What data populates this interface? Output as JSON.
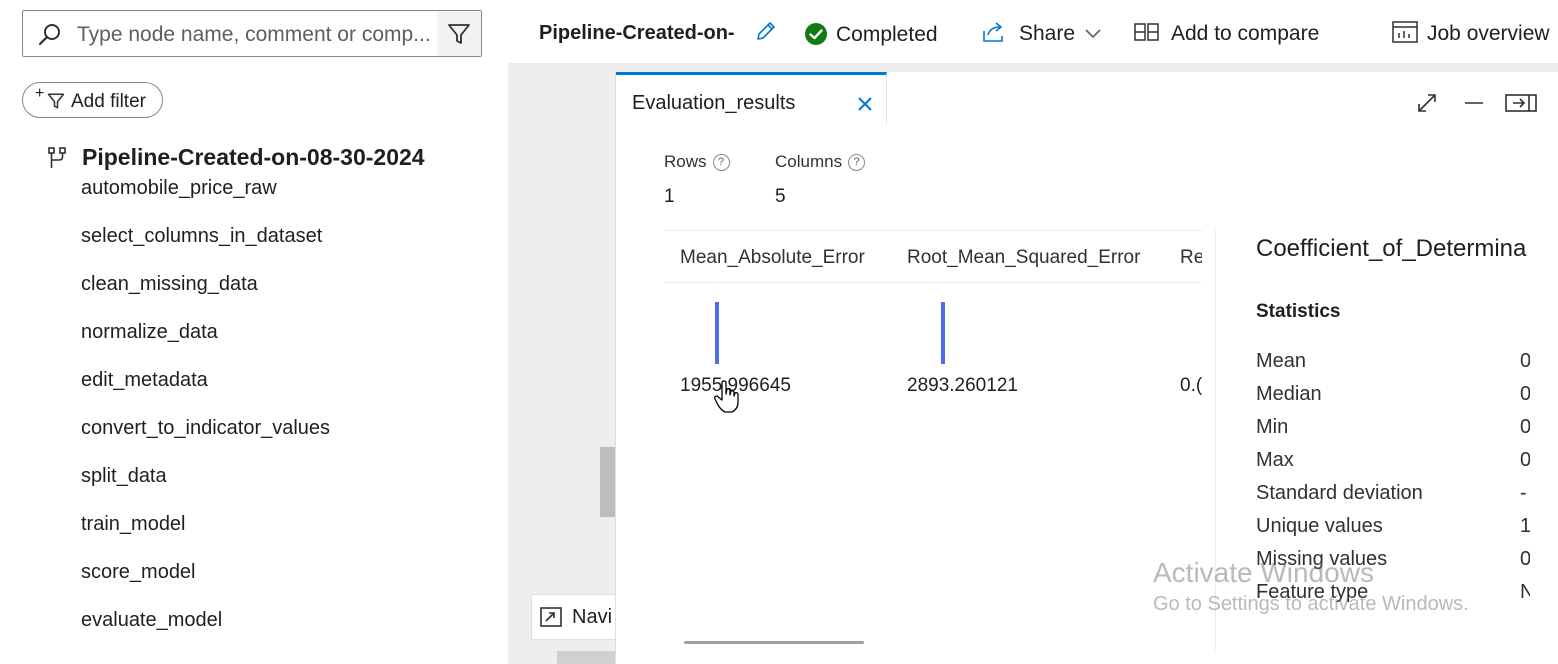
{
  "search": {
    "placeholder": "Type node name, comment or comp..."
  },
  "filter": {
    "add_label": "Add filter"
  },
  "pipeline": {
    "title": "Pipeline-Created-on-08-30-2024",
    "nodes": [
      "automobile_price_raw",
      "select_columns_in_dataset",
      "clean_missing_data",
      "normalize_data",
      "edit_metadata",
      "convert_to_indicator_values",
      "split_data",
      "train_model",
      "score_model",
      "evaluate_model"
    ]
  },
  "header": {
    "job_name": "Pipeline-Created-on-",
    "status": "Completed",
    "share_label": "Share",
    "compare_label": "Add to compare",
    "job_overview_label": "Job overview"
  },
  "canvas": {
    "navi_label": "Navi"
  },
  "results": {
    "tab_label": "Evaluation_results",
    "rows_label": "Rows",
    "rows_value": "1",
    "columns_label": "Columns",
    "columns_value": "5",
    "columns": [
      {
        "name": "Mean_Absolute_Error",
        "value": "1955.996645"
      },
      {
        "name": "Root_Mean_Squared_Error",
        "value": "2893.260121"
      },
      {
        "name": "Re",
        "value": "0.("
      }
    ],
    "selected_column": "Coefficient_of_Determina",
    "statistics_heading": "Statistics",
    "statistics": [
      {
        "label": "Mean",
        "value": "0"
      },
      {
        "label": "Median",
        "value": "0"
      },
      {
        "label": "Min",
        "value": "0"
      },
      {
        "label": "Max",
        "value": "0"
      },
      {
        "label": "Standard deviation",
        "value": "-"
      },
      {
        "label": "Unique values",
        "value": "1"
      },
      {
        "label": "Missing values",
        "value": "0"
      },
      {
        "label": "Feature type",
        "value": "N"
      }
    ]
  },
  "watermark": {
    "line1": "Activate Windows",
    "line2": "Go to Settings to activate Windows."
  },
  "colors": {
    "accent": "#0078d4",
    "status_success": "#107c10",
    "histogram": "#4f6bed"
  }
}
